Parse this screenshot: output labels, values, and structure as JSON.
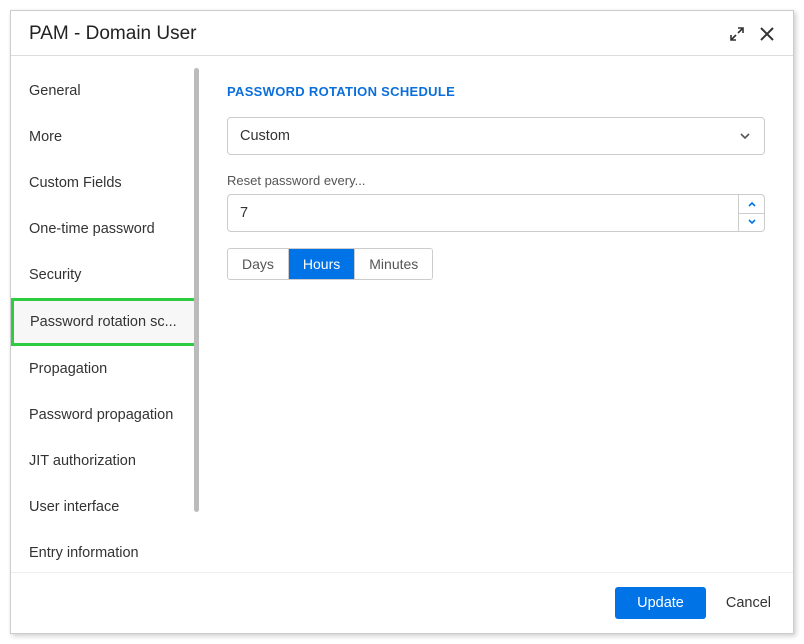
{
  "dialog": {
    "title": "PAM - Domain User"
  },
  "sidebar": {
    "items": [
      {
        "label": "General"
      },
      {
        "label": "More"
      },
      {
        "label": "Custom Fields"
      },
      {
        "label": "One-time password"
      },
      {
        "label": "Security"
      },
      {
        "label": "Password rotation sc...",
        "selected": true
      },
      {
        "label": "Propagation"
      },
      {
        "label": "Password propagation"
      },
      {
        "label": "JIT authorization"
      },
      {
        "label": "User interface"
      },
      {
        "label": "Entry information"
      }
    ]
  },
  "content": {
    "section_heading": "PASSWORD ROTATION SCHEDULE",
    "schedule_type": "Custom",
    "reset_label": "Reset password every...",
    "reset_value": "7",
    "units": {
      "days": "Days",
      "hours": "Hours",
      "minutes": "Minutes",
      "active": "hours"
    }
  },
  "footer": {
    "update": "Update",
    "cancel": "Cancel"
  }
}
